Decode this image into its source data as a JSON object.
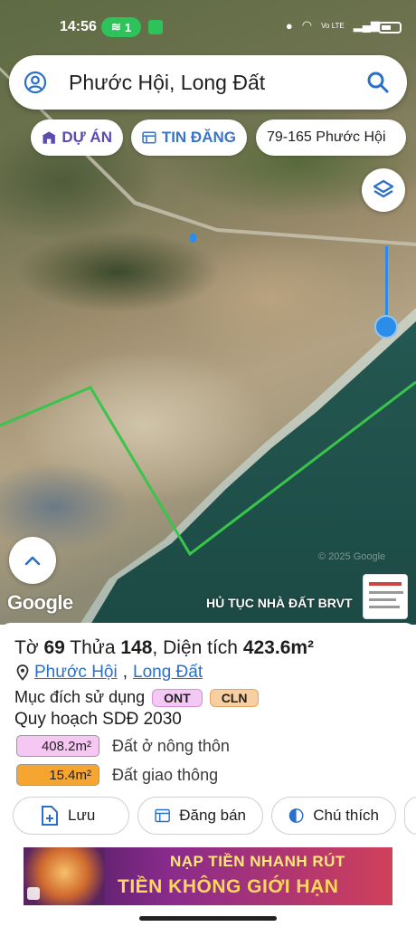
{
  "status_bar": {
    "time": "14:56",
    "hotspot_count": "1",
    "network_label": "Vo LTE"
  },
  "search": {
    "query": "Phước Hội, Long Đất"
  },
  "chips": {
    "project": "DỰ ÁN",
    "listing": "TIN ĐĂNG",
    "address": "79-165 Phước Hội"
  },
  "map": {
    "google_logo": "Google",
    "copyright": "© 2025 Google",
    "banner_text": "HỦ TỤC NHÀ ĐẤT BRVT",
    "boundary_color": "#39c44a",
    "location_color": "#2b8de8"
  },
  "parcel": {
    "sheet_label": "Tờ",
    "sheet": "69",
    "plot_label": "Thửa",
    "plot": "148",
    "area_label": "Diện tích",
    "area": "423.6m²",
    "ward": "Phước Hội",
    "district": "Long Đất",
    "purpose_label": "Mục đích sử dụng",
    "purpose_codes": [
      "ONT",
      "CLN"
    ],
    "plan_label": "Quy hoạch SDĐ 2030",
    "zones": [
      {
        "area": "408.2m²",
        "name": "Đất ở nông thôn",
        "color": "#f6c7f3"
      },
      {
        "area": "15.4m²",
        "name": "Đất giao thông",
        "color": "#f6a531"
      }
    ]
  },
  "actions": {
    "save": "Lưu",
    "sell": "Đăng bán",
    "legend": "Chú thích"
  },
  "ad": {
    "line1": "NẠP TIỀN NHANH RÚT",
    "line2": "TIỀN KHÔNG GIỚI HẠN"
  }
}
